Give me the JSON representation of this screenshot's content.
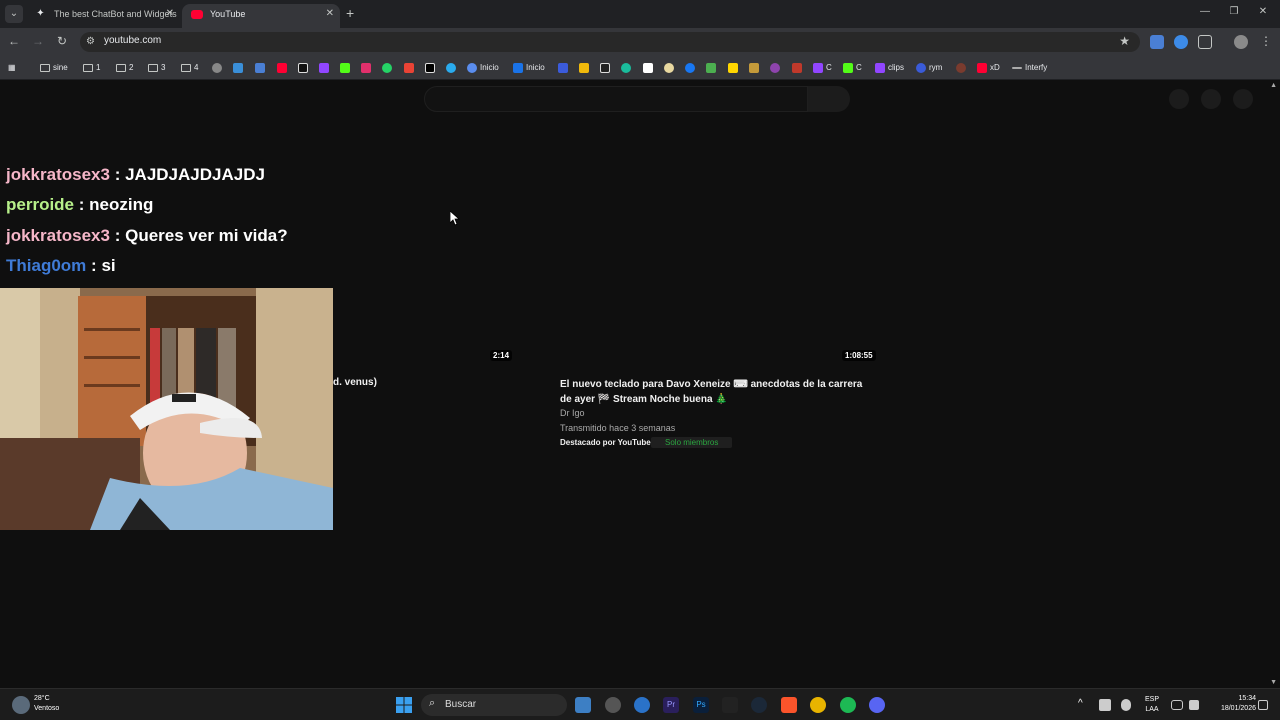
{
  "browser": {
    "tabs": [
      {
        "title": "The best ChatBot and Widgets",
        "active": false
      },
      {
        "title": "YouTube",
        "active": true
      }
    ],
    "url": "youtube.com",
    "bookmarks": [
      {
        "label": "sine"
      },
      {
        "label": "1"
      },
      {
        "label": "2"
      },
      {
        "label": "3"
      },
      {
        "label": "4"
      },
      {
        "label": "Inicio"
      },
      {
        "label": "Inicio"
      },
      {
        "label": "C"
      },
      {
        "label": "C"
      },
      {
        "label": "clips"
      },
      {
        "label": "rym"
      },
      {
        "label": "xD"
      },
      {
        "label": "Interfy"
      }
    ]
  },
  "chat": [
    {
      "user": "jokkratosex3",
      "message": "JAJDJAJDJAJDJ",
      "color": "#f5b6c8"
    },
    {
      "user": "perroide",
      "message": "neozing",
      "color": "#b7f08a"
    },
    {
      "user": "jokkratosex3",
      "message": "Queres ver mi vida?",
      "color": "#f5b6c8"
    },
    {
      "user": "Thiag0om",
      "message": "si",
      "color": "#3f7bd6"
    }
  ],
  "chat_separator": ":",
  "videos": {
    "left_duration": "2:14",
    "left_title_fragment": "d. venus)",
    "right_duration": "1:08:55",
    "right_title": "El nuevo teclado para Davo Xeneize ⌨ anecdotas de la carrera de ayer 🏁 Stream Noche buena 🎄",
    "right_channel": "Dr Igo",
    "right_streamed": "Transmitido hace 3 semanas",
    "right_featured": "Destacado por YouTube",
    "right_badge": "Solo miembros"
  },
  "taskbar": {
    "weather_temp": "28°C",
    "weather_desc": "Ventoso",
    "search_label": "Buscar",
    "lang": "ESP",
    "lang_sub": "LAA",
    "time": "15:34",
    "date": "18/01/2026"
  },
  "colors": {
    "page_bg": "#0f0f0f",
    "chrome_bg": "#35363a",
    "tabstrip_bg": "#202124",
    "taskbar_bg": "#1c1c1c"
  }
}
